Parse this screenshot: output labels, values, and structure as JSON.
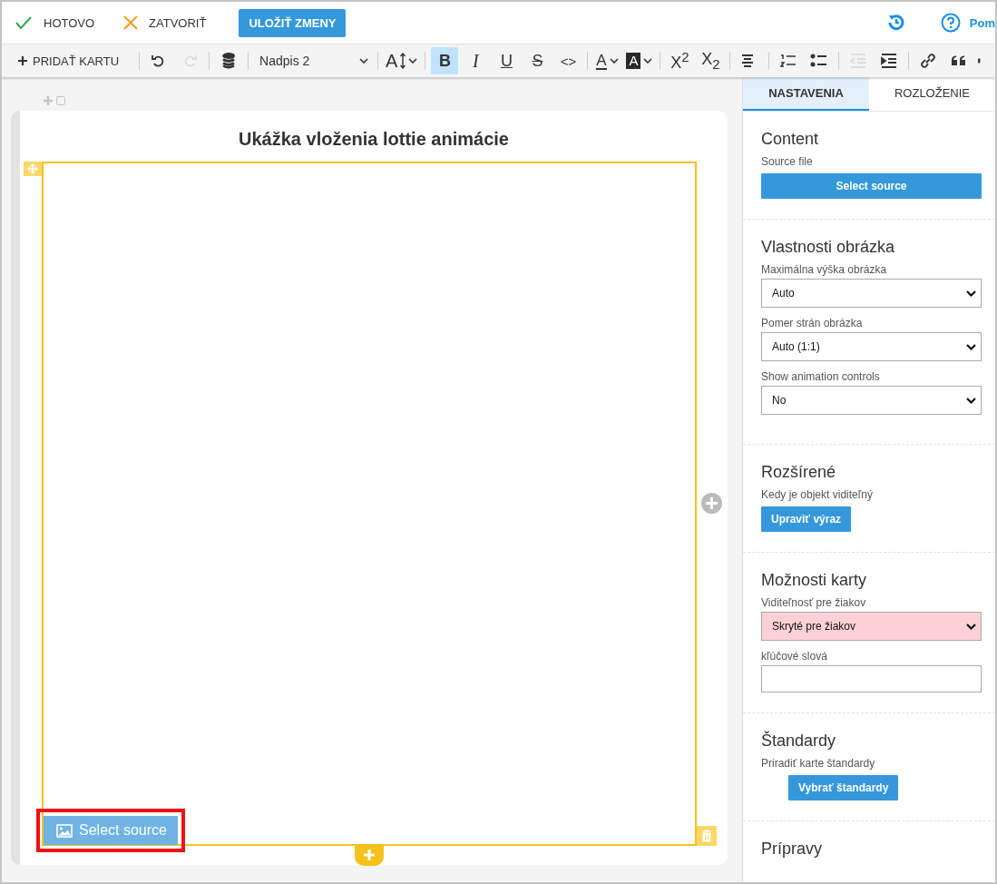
{
  "top_bar": {
    "actions": [
      {
        "kind": "done",
        "label": "HOTOVO"
      },
      {
        "kind": "close",
        "label": "ZATVORIŤ"
      }
    ],
    "save_button": "ULOŽIŤ ZMENY",
    "help_link": "Pom"
  },
  "toolbar": {
    "add_card": "PRIDAŤ KARTU",
    "style_select": "Nadpis 2",
    "groups": [
      [
        {
          "kind": "undo",
          "selected": false,
          "disabled": false
        },
        {
          "kind": "redo",
          "selected": false,
          "disabled": true
        }
      ],
      [
        {
          "kind": "database",
          "selected": false,
          "disabled": false
        }
      ],
      [
        {
          "kind": "style-select"
        }
      ],
      [
        {
          "kind": "font-size",
          "label": "A",
          "selected": false,
          "disabled": false
        }
      ],
      [
        {
          "kind": "bold",
          "label": "B",
          "selected": true,
          "disabled": false
        },
        {
          "kind": "italic",
          "label": "I",
          "selected": false,
          "disabled": false
        },
        {
          "kind": "underline",
          "label": "U",
          "selected": false,
          "disabled": false
        },
        {
          "kind": "strike",
          "label": "S",
          "selected": false,
          "disabled": false
        },
        {
          "kind": "code",
          "label": "<>",
          "selected": false,
          "disabled": false
        }
      ],
      [
        {
          "kind": "text-color",
          "label": "A",
          "selected": false,
          "disabled": false
        },
        {
          "kind": "highlight",
          "label": "A",
          "selected": false,
          "disabled": false
        }
      ],
      [
        {
          "kind": "script",
          "label": "X$^{2}$",
          "selected": false,
          "disabled": false
        },
        {
          "kind": "script",
          "label": "X$_{2}$",
          "selected": false,
          "disabled": false
        }
      ],
      [
        {
          "kind": "align",
          "selected": false,
          "disabled": false
        }
      ],
      [
        {
          "kind": "ordered-list",
          "selected": false,
          "disabled": false
        },
        {
          "kind": "bullet-list",
          "selected": false,
          "disabled": false
        }
      ],
      [
        {
          "kind": "outdent",
          "selected": false,
          "disabled": true
        },
        {
          "kind": "indent",
          "selected": false,
          "disabled": false
        }
      ],
      [
        {
          "kind": "link",
          "selected": false,
          "disabled": false
        },
        {
          "kind": "quote",
          "selected": false,
          "disabled": false
        },
        {
          "kind": "more",
          "selected": false,
          "disabled": false
        }
      ]
    ]
  },
  "canvas": {
    "title": "Ukážka vloženia lottie animácie",
    "select_button": {
      "label": "Select source",
      "outlined": true
    }
  },
  "panel": {
    "tabs": [
      {
        "label": "NASTAVENIA",
        "selected": true
      },
      {
        "label": "ROZLOŽENIE",
        "selected": false
      }
    ],
    "sections": [
      {
        "title": "Content",
        "fields": [
          {
            "kind": "label",
            "text": "Source file"
          },
          {
            "kind": "wide-button",
            "label": "Select source"
          }
        ]
      },
      {
        "title": "Vlastnosti obrázka",
        "fields": [
          {
            "kind": "label",
            "text": "Maximálna výška obrázka"
          },
          {
            "kind": "select",
            "value": "Auto",
            "warning": false
          },
          {
            "kind": "label",
            "text": "Pomer strán obrázka"
          },
          {
            "kind": "select",
            "value": "Auto (1:1)",
            "warning": false
          },
          {
            "kind": "label",
            "text": "Show animation controls"
          },
          {
            "kind": "select",
            "value": "No",
            "warning": false
          }
        ]
      },
      {
        "title": "Rozšírené",
        "fields": [
          {
            "kind": "label",
            "text": "Kedy je objekt viditeľný"
          },
          {
            "kind": "button",
            "label": "Upraviť výraz"
          }
        ]
      },
      {
        "title": "Možnosti karty",
        "fields": [
          {
            "kind": "label",
            "text": "Viditeľnosť pre žiakov"
          },
          {
            "kind": "select",
            "value": "Skryté pre žiakov",
            "warning": true
          },
          {
            "kind": "label",
            "text": "kľúčové slová"
          },
          {
            "kind": "input"
          }
        ]
      },
      {
        "title": "Štandardy",
        "fields": [
          {
            "kind": "label",
            "text": "Priradiť karte štandardy"
          },
          {
            "kind": "indented-button",
            "label": "Vybrať štandardy"
          }
        ]
      },
      {
        "title": "Prípravy"
      }
    ]
  }
}
